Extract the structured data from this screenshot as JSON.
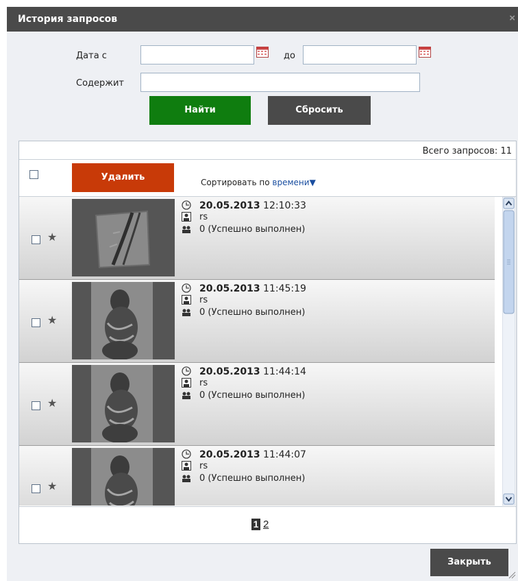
{
  "dialog": {
    "title": "История запросов",
    "close_icon": "×"
  },
  "filters": {
    "date_from_label": "Дата с",
    "date_to_label": "до",
    "date_from_value": "",
    "date_to_value": "",
    "contains_label": "Содержит",
    "contains_value": "",
    "find_label": "Найти",
    "reset_label": "Сбросить"
  },
  "list": {
    "total_text": "Всего запросов: 11",
    "delete_label": "Удалить",
    "sort_prefix": "Сортировать по",
    "sort_field": "времени",
    "sort_arrow": "▼",
    "rows": [
      {
        "date": "20.05.2013",
        "time": "12:10:33",
        "user": "rs",
        "result": "0  (Успешно выполнен)",
        "thumb": "texture"
      },
      {
        "date": "20.05.2013",
        "time": "11:45:19",
        "user": "rs",
        "result": "0  (Успешно выполнен)",
        "thumb": "person"
      },
      {
        "date": "20.05.2013",
        "time": "11:44:14",
        "user": "rs",
        "result": "0  (Успешно выполнен)",
        "thumb": "person"
      },
      {
        "date": "20.05.2013",
        "time": "11:44:07",
        "user": "rs",
        "result": "0  (Успешно выполнен)",
        "thumb": "person"
      }
    ]
  },
  "pagination": {
    "current": "1",
    "next": "2"
  },
  "footer": {
    "close_label": "Закрыть"
  },
  "colors": {
    "find": "#0f7d0f",
    "reset": "#4a4a4a",
    "delete": "#c83a08",
    "titlebar": "#4a4a4a"
  }
}
